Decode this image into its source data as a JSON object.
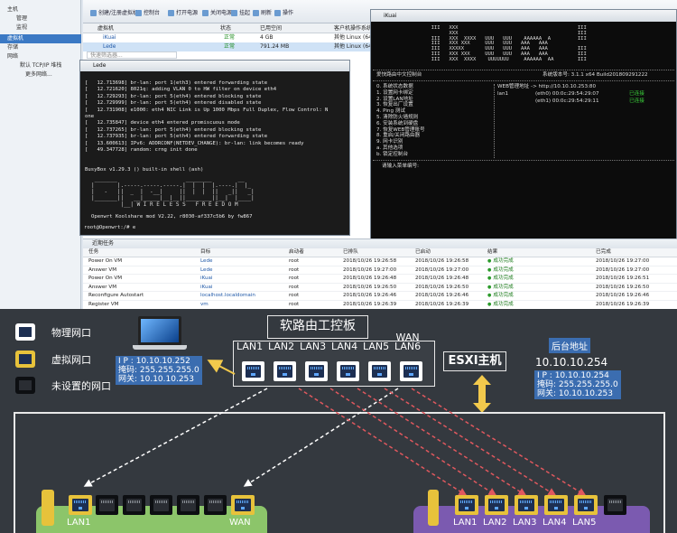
{
  "nav": {
    "items": [
      "主机",
      "管理",
      "监视",
      "虚拟机",
      "存储",
      "网络",
      "默认 TCP/IP 堆栈",
      "更多网络..."
    ]
  },
  "toolbar": {
    "buttons": [
      "创建/注册虚拟机",
      "控制台",
      "打开电源",
      "关闭电源",
      "挂起",
      "刷新",
      "操作"
    ]
  },
  "vm_table": {
    "headers": [
      "虚拟机",
      "状态",
      "已用空间",
      "客户机操作系统"
    ],
    "rows": [
      {
        "name": "iKuai",
        "status": "正常",
        "space": "4 GB",
        "os": "其他 Linux (64 位)"
      },
      {
        "name": "Lede",
        "status": "正常",
        "space": "791.24 MB",
        "os": "其他 Linux (64 位)"
      }
    ],
    "quick_filter": "快速筛选器..."
  },
  "lede": {
    "title": "Lede",
    "log": "[   12.713698] br-lan: port 1(eth3) entered forwarding state\n[   12.721620] 8021q: adding VLAN 0 to HW filter on device eth4\n[   12.729293] br-lan: port 5(eth4) entered blocking state\n[   12.729999] br-lan: port 5(eth4) entered disabled state\n[   12.731908] e1000: eth4 NIC Link is Up 1000 Mbps Full Duplex, Flow Control: N\none\n[   12.735847] device eth4 entered promiscuous mode\n[   12.737265] br-lan: port 5(eth4) entered blocking state\n[   12.737935] br-lan: port 5(eth4) entered forwarding state\n[   13.600613] IPv6: ADDRCONF(NETDEV_CHANGE): br-lan: link becomes ready\n[   49.347728] random: crng init done\n\n\nBusyBox v1.29.3 () built-in shell (ash)",
    "banner": " _______                     ________        __\n|       |.-----.-----.-----.|  |  |  |.----.|  |_\n|   -   ||  _  |  -__|     ||  |  |  ||   _||   _|\n|_______||   __|_____|__|__||________||__|  |____|\n         |__| W I R E L E S S   F R E E D O M",
    "version": "Openwrt Koolshare mod V2.22, r8030-af337c5b6 by fw867",
    "prompt": "root@Openwrt:/# e"
  },
  "ikuai": {
    "title": "iKuai",
    "logo": "  III   XXX                                        III\n        XXX                                        III\n  III   XXX  XXXX   UUU   UUU    AAAAAA  A         III\n  III   XXX XXX     UUU   UUU   AAA   AAA\n  III   XXXXX       UUU   UUU   AAA   AAA          III\n  III   XXX XXX     UUU   UUU   AAA   AAA          III\n  III   XXX  XXXX    UUUUUUU     AAAAAA  AA        III",
    "header_left": "爱快路由中文控制台",
    "header_right": "系统版本号: 3.1.1 x64 Build201809291222",
    "menu": [
      "0. 系统状态数据",
      "1. 设置网卡绑定",
      "2. 设置LAN地址",
      "3. 恢复出厂设置",
      "4. Ping 测试",
      "5. 清除防火墙规则",
      "6. 安装系统到硬盘",
      "7. 恢复WEB管理账号",
      "8. 重启/关闭路由器",
      "9. 网卡识别",
      "a. 其他选项",
      "b. 锁定控制台"
    ],
    "web_label": "WEB管理地址 -> http://10.10.10.253:80",
    "lan": [
      "lan1",
      "(eth0)  00:0c:29:54:29:07",
      "已连接"
    ],
    "wan": [
      "",
      "(eth1)  00:0c:29:54:29:11",
      "已连接"
    ],
    "prompt": "请输入菜单编号:"
  },
  "tasks": {
    "title": "近期任务",
    "headers": [
      "任务",
      "目标",
      "启动者",
      "已排队",
      "已启动",
      "结果",
      "已完成"
    ],
    "rows": [
      [
        "Power On VM",
        "Lede",
        "root",
        "2018/10/26 19:26:58",
        "2018/10/26 19:26:58",
        "成功完成",
        "2018/10/26 19:27:00"
      ],
      [
        "Answer VM",
        "Lede",
        "root",
        "2018/10/26 19:27:00",
        "2018/10/26 19:27:00",
        "成功完成",
        "2018/10/26 19:27:00"
      ],
      [
        "Power On VM",
        "iKuai",
        "root",
        "2018/10/26 19:26:48",
        "2018/10/26 19:26:48",
        "成功完成",
        "2018/10/26 19:26:51"
      ],
      [
        "Answer VM",
        "iKuai",
        "root",
        "2018/10/26 19:26:50",
        "2018/10/26 19:26:50",
        "成功完成",
        "2018/10/26 19:26:50"
      ],
      [
        "Reconfigure Autostart",
        "localhost.localdomain",
        "root",
        "2018/10/26 19:26:46",
        "2018/10/26 19:26:46",
        "成功完成",
        "2018/10/26 19:26:46"
      ],
      [
        "Register VM",
        "vm",
        "root",
        "2018/10/26 19:26:39",
        "2018/10/26 19:26:39",
        "成功完成",
        "2018/10/26 19:26:39"
      ]
    ]
  },
  "diagram": {
    "legend": [
      "物理网口",
      "虚拟网口",
      "未设置的网口"
    ],
    "router_title": "软路由工控板",
    "router_ports": [
      "LAN1",
      "LAN2",
      "LAN3",
      "LAN4",
      "LAN5",
      "WAN\nLAN6"
    ],
    "esxi_label": "ESXI主机",
    "laptop_ip": {
      "ip": "I P : 10.10.10.252",
      "mask": "掩码: 255.255.255.0",
      "gw": "网关: 10.10.10.253"
    },
    "backend_title": "后台地址",
    "backend_addr": "10.10.10.254",
    "backend_ip": {
      "ip": "I P : 10.10.10.254",
      "mask": "掩码: 255.255.255.0",
      "gw": "网关: 10.10.10.253"
    },
    "left_vm_ports": [
      "LAN1",
      "WAN"
    ],
    "right_vm_ports": [
      "LAN1",
      "LAN2",
      "LAN3",
      "LAN4",
      "LAN5"
    ],
    "colors": {
      "board": "#34393f",
      "accent_blue": "#3b6db0",
      "arrow_red": "#e0585e",
      "yellow": "#e7c23b",
      "green_vm": "#8cc56a",
      "purple_vm": "#7b5ab0"
    }
  }
}
